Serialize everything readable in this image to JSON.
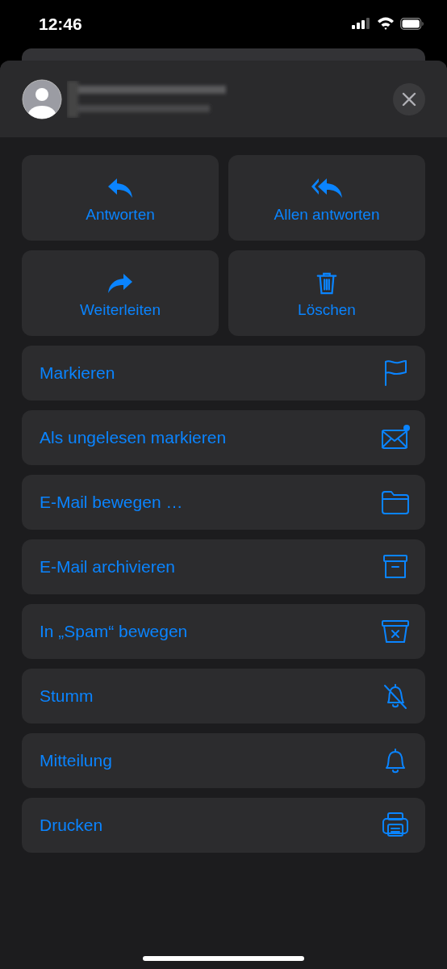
{
  "status_bar": {
    "time": "12:46"
  },
  "actions": [
    {
      "label": "Antworten"
    },
    {
      "label": "Allen antworten"
    },
    {
      "label": "Weiterleiten"
    },
    {
      "label": "Löschen"
    }
  ],
  "menu": [
    {
      "label": "Markieren"
    },
    {
      "label": "Als ungelesen markieren"
    },
    {
      "label": "E-Mail bewegen …"
    },
    {
      "label": "E-Mail archivieren"
    },
    {
      "label": "In „Spam“ bewegen"
    },
    {
      "label": "Stumm"
    },
    {
      "label": "Mitteilung"
    },
    {
      "label": "Drucken"
    }
  ]
}
